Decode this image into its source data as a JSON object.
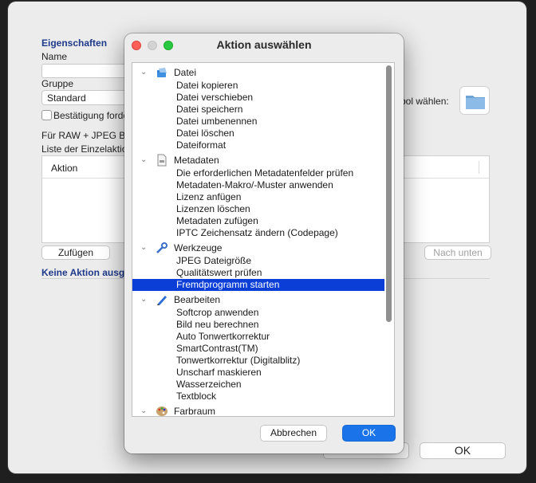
{
  "background": {
    "section_properties": "Eigenschaften",
    "name_label": "Name",
    "group_label": "Gruppe",
    "group_value": "Standard",
    "confirm_checkbox_label": "Bestätigung forde",
    "raw_jpeg_label": "Für RAW + JPEG Bü",
    "action_list_label": "Liste der Einzelaktio",
    "table_header_action": "Aktion",
    "add_button": "Zufügen",
    "move_down_button": "Nach unten",
    "symbol_label": "bol wählen:",
    "no_action_label": "Keine Aktion ausge",
    "ok_button": "OK"
  },
  "dialog": {
    "title": "Aktion auswählen",
    "cancel_button": "Abbrechen",
    "ok_button": "OK",
    "categories": [
      {
        "label": "Datei",
        "icon": "file-icon",
        "items": [
          "Datei kopieren",
          "Datei verschieben",
          "Datei speichern",
          "Datei umbenennen",
          "Datei löschen",
          "Dateiformat"
        ]
      },
      {
        "label": "Metadaten",
        "icon": "metadata-icon",
        "items": [
          "Die erforderlichen Metadatenfelder prüfen",
          "Metadaten-Makro/-Muster anwenden",
          "Lizenz anfügen",
          "Lizenzen löschen",
          "Metadaten zufügen",
          "IPTC Zeichensatz ändern (Codepage)"
        ]
      },
      {
        "label": "Werkzeuge",
        "icon": "tools-icon",
        "items": [
          "JPEG Dateigröße",
          "Qualitätswert prüfen",
          "Fremdprogramm starten"
        ]
      },
      {
        "label": "Bearbeiten",
        "icon": "edit-pencil-icon",
        "items": [
          "Softcrop anwenden",
          "Bild neu berechnen",
          "Auto Tonwertkorrektur",
          "SmartContrast(TM)",
          "Tonwertkorrektur (Digitalblitz)",
          "Unscharf maskieren",
          "Wasserzeichen",
          "Textblock"
        ]
      },
      {
        "label": "Farbraum",
        "icon": "palette-icon",
        "items": []
      }
    ],
    "selected_item": "Fremdprogramm starten"
  },
  "colors": {
    "selection": "#0a3ed6",
    "accent": "#1a73e8",
    "section_title": "#1f3a8a"
  }
}
